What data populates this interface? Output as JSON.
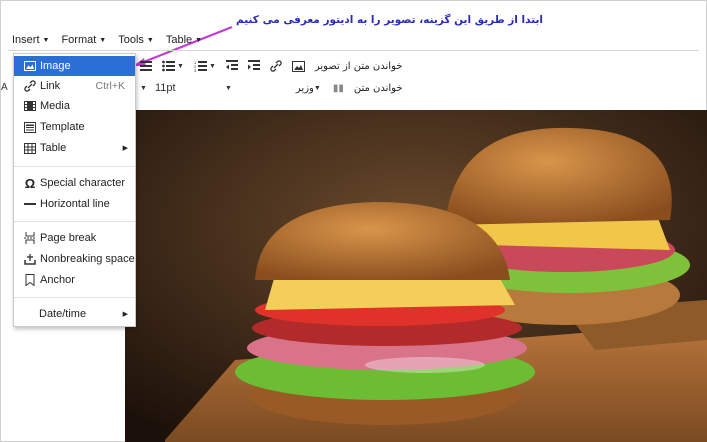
{
  "annotation": {
    "text": "ابتدا از طریق این گزینه، تصویر را به ادیتور معرفی می کنیم",
    "arrow_color": "#c23bd4",
    "text_color": "#2a2ab8"
  },
  "menubar": {
    "items": [
      "Insert",
      "Format",
      "Tools",
      "Table"
    ]
  },
  "toolbar1": {
    "image_text": "خواندن متن از تصویر"
  },
  "toolbar2": {
    "font_size": "11pt",
    "font_family": "وزیر",
    "read_text": "خواندن متن",
    "left_letter": "A"
  },
  "insert_menu": {
    "items": [
      {
        "label": "Image",
        "icon": "image-icon",
        "active": true
      },
      {
        "label": "Link",
        "icon": "link-icon",
        "shortcut": "Ctrl+K"
      },
      {
        "label": "Media",
        "icon": "media-icon"
      },
      {
        "label": "Template",
        "icon": "template-icon"
      },
      {
        "label": "Table",
        "icon": "table-icon",
        "submenu": true
      },
      {
        "label": "Special character",
        "icon": "omega-icon"
      },
      {
        "label": "Horizontal line",
        "icon": "horizontal-line-icon"
      },
      {
        "label": "Page break",
        "icon": "page-break-icon"
      },
      {
        "label": "Nonbreaking space",
        "icon": "nonbreaking-space-icon"
      },
      {
        "label": "Anchor",
        "icon": "bookmark-icon"
      },
      {
        "label": "Date/time",
        "submenu": true
      }
    ]
  },
  "colors": {
    "accent": "#2b6fd6"
  }
}
